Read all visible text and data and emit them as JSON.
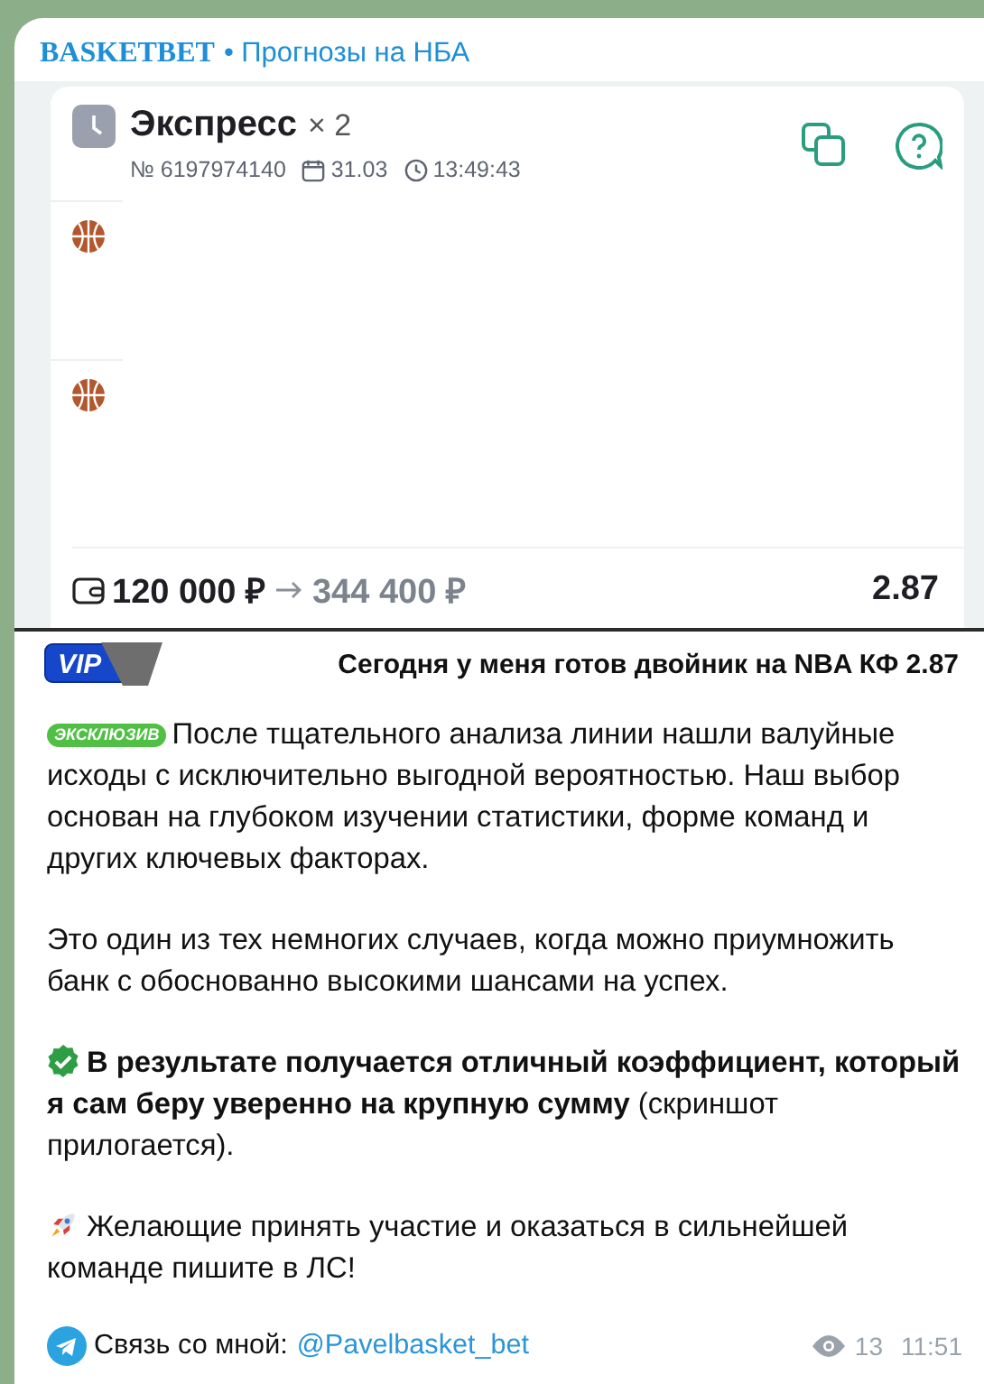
{
  "header": {
    "channel_name": "BASKETBET",
    "channel_title": "• Прогнозы на НБА"
  },
  "bet_card": {
    "title": "Экспресс",
    "multiplier": "× 2",
    "number": "№ 6197974140",
    "date": "31.03",
    "time": "13:49:43",
    "legs": [
      {
        "kind": "basketball"
      },
      {
        "kind": "basketball"
      }
    ],
    "stake": "120 000 ₽",
    "payout": "344 400 ₽",
    "odds": "2.87"
  },
  "vip": {
    "badge": "VIP",
    "headline": "Сегодня у меня готов двойник на NBA КФ 2.87"
  },
  "paragraphs": [
    {
      "kind": "exclusive",
      "badge": "ЭКСКЛЮЗИВ",
      "text": "После тщательного анализа линии нашли валуйные исходы с исключительно выгодной вероятностью. Наш выбор основан на глубоком изучении статистики, форме команд и других ключевых факторах."
    },
    {
      "kind": "plain",
      "text": "Это один из тех немногих случаев, когда можно приумножить банк с обоснованно высокими шансами на успех."
    },
    {
      "kind": "check",
      "text": "**В результате получается отличный коэффициент, который я сам беру уверенно на крупную сумму** (скриншот прилогается)."
    },
    {
      "kind": "rocket",
      "text": "Желающие принять участие и оказаться в сильнейшей команде пишите в ЛС!"
    }
  ],
  "footer": {
    "contact_label": "Связь со мной:",
    "contact_link": "@Pavelbasket_bet",
    "views": "13",
    "time": "11:51"
  }
}
